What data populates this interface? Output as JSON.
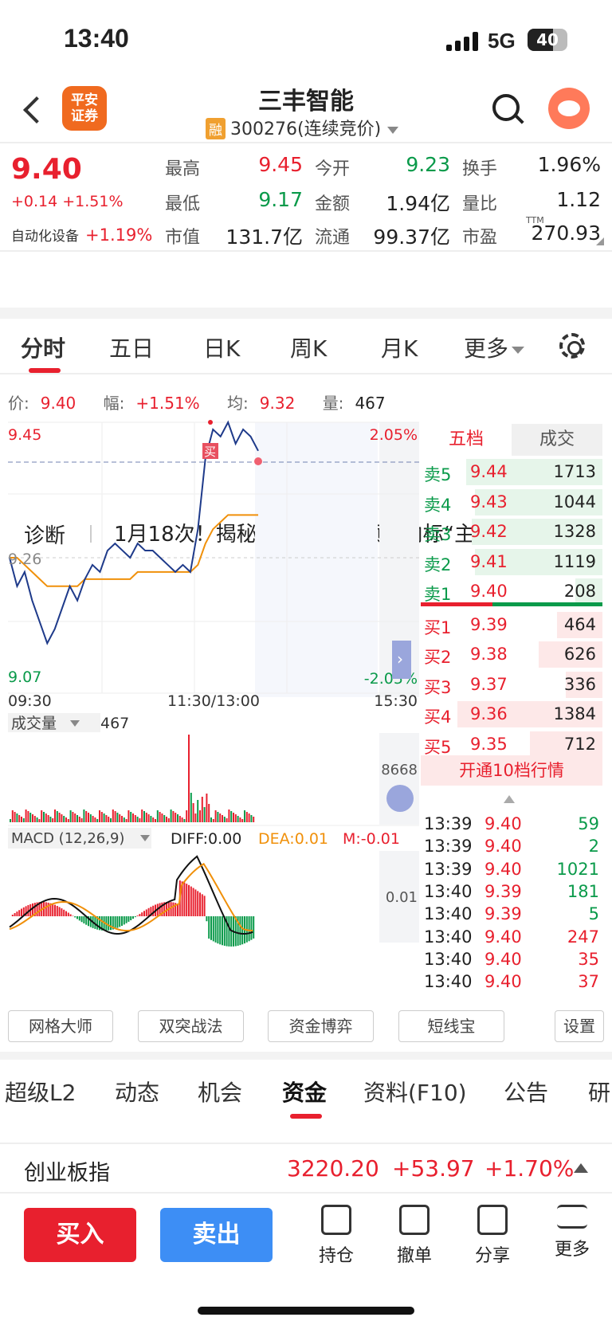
{
  "status": {
    "time": "13:40",
    "network": "5G",
    "battery": "40"
  },
  "header": {
    "title": "三丰智能",
    "code": "300276(连续竞价)",
    "rong": "融",
    "logo_top": "平安",
    "logo_bottom": "证券"
  },
  "quote": {
    "price": "9.40",
    "change": "+0.14 +1.51%",
    "sector_name": "自动化设备",
    "sector_change": "+1.19%",
    "fields": [
      {
        "l": "最高",
        "v": "9.45",
        "c": "red"
      },
      {
        "l": "今开",
        "v": "9.23",
        "c": "green"
      },
      {
        "l": "换手",
        "v": "1.96%",
        "c": ""
      },
      {
        "l": "最低",
        "v": "9.17",
        "c": "green"
      },
      {
        "l": "金额",
        "v": "1.94亿",
        "c": ""
      },
      {
        "l": "量比",
        "v": "1.12",
        "c": ""
      },
      {
        "l": "市值",
        "v": "131.7亿",
        "c": ""
      },
      {
        "l": "流通",
        "v": "99.37亿",
        "c": ""
      },
      {
        "l": "市盈",
        "v": "270.93",
        "c": ""
      }
    ],
    "ttm": "TTM"
  },
  "diagnosis": {
    "label": "诊断",
    "text": "1月18次！揭秘三丰智能高频风向标“主力”",
    "close": "✕"
  },
  "tabs": [
    "分时",
    "五日",
    "日K",
    "周K",
    "月K",
    "更多"
  ],
  "info": {
    "price_label": "价:",
    "price": "9.40",
    "amp_label": "幅:",
    "amp": "+1.51%",
    "avg_label": "均:",
    "avg": "9.32",
    "vol_label": "量:",
    "vol": "467"
  },
  "chart": {
    "y_high": "9.45",
    "y_mid": "9.26",
    "y_low": "9.07",
    "pct_high": "2.05%",
    "pct_low": "-2.05%",
    "x_start": "09:30",
    "x_mid": "11:30/13:00",
    "x_end": "15:30",
    "buy_mark": "买",
    "vol_label": "成交量",
    "vol_value": "467",
    "vol_max": "8668",
    "macd_label": "MACD (12,26,9)",
    "diff": "DIFF:0.00",
    "dea": "DEA:0.01",
    "m": "M:-0.01",
    "macd_axis": "0.01",
    "price_series": [
      9.26,
      9.22,
      9.24,
      9.2,
      9.17,
      9.14,
      9.16,
      9.19,
      9.22,
      9.2,
      9.23,
      9.25,
      9.24,
      9.27,
      9.28,
      9.27,
      9.26,
      9.28,
      9.27,
      9.27,
      9.26,
      9.25,
      9.24,
      9.25,
      9.24,
      9.3,
      9.4,
      9.44,
      9.43,
      9.45,
      9.42,
      9.44,
      9.43,
      9.41
    ],
    "avg_series": [
      9.26,
      9.26,
      9.25,
      9.24,
      9.23,
      9.22,
      9.22,
      9.22,
      9.22,
      9.22,
      9.23,
      9.23,
      9.23,
      9.23,
      9.23,
      9.23,
      9.23,
      9.24,
      9.24,
      9.24,
      9.24,
      9.24,
      9.24,
      9.24,
      9.24,
      9.25,
      9.28,
      9.3,
      9.31,
      9.32,
      9.32,
      9.32,
      9.32,
      9.32
    ]
  },
  "orderbook": {
    "tab_a": "五档",
    "tab_b": "成交",
    "asks": [
      {
        "n": "卖5",
        "p": "9.44",
        "v": "1713",
        "w": 0.75
      },
      {
        "n": "卖4",
        "p": "9.43",
        "v": "1044",
        "w": 0.7
      },
      {
        "n": "卖3",
        "p": "9.42",
        "v": "1328",
        "w": 0.72
      },
      {
        "n": "卖2",
        "p": "9.41",
        "v": "1119",
        "w": 0.7
      },
      {
        "n": "卖1",
        "p": "9.40",
        "v": "208",
        "w": 0.15
      }
    ],
    "bids": [
      {
        "n": "买1",
        "p": "9.39",
        "v": "464",
        "w": 0.25
      },
      {
        "n": "买2",
        "p": "9.38",
        "v": "626",
        "w": 0.35
      },
      {
        "n": "买3",
        "p": "9.37",
        "v": "336",
        "w": 0.2
      },
      {
        "n": "买4",
        "p": "9.36",
        "v": "1384",
        "w": 0.8
      },
      {
        "n": "买5",
        "p": "9.35",
        "v": "712",
        "w": 0.4
      }
    ],
    "open10": "开通10档行情"
  },
  "ticks": [
    {
      "t": "13:39",
      "p": "9.40",
      "v": "59",
      "c": "green"
    },
    {
      "t": "13:39",
      "p": "9.40",
      "v": "2",
      "c": "green"
    },
    {
      "t": "13:39",
      "p": "9.40",
      "v": "1021",
      "c": "green"
    },
    {
      "t": "13:40",
      "p": "9.39",
      "v": "181",
      "c": "green"
    },
    {
      "t": "13:40",
      "p": "9.39",
      "v": "5",
      "c": "green"
    },
    {
      "t": "13:40",
      "p": "9.40",
      "v": "247",
      "c": "red"
    },
    {
      "t": "13:40",
      "p": "9.40",
      "v": "35",
      "c": "red"
    },
    {
      "t": "13:40",
      "p": "9.40",
      "v": "37",
      "c": "red"
    }
  ],
  "tools": [
    "网格大师",
    "双突战法",
    "资金博弈",
    "短线宝",
    "设置"
  ],
  "bottom_tabs": [
    "超级L2",
    "动态",
    "机会",
    "资金",
    "资料(F10)",
    "公告",
    "研"
  ],
  "index": {
    "name": "创业板指",
    "value": "3220.20",
    "change": "+53.97",
    "pct": "+1.70%"
  },
  "actions": {
    "buy": "买入",
    "sell": "卖出",
    "hold": "持仓",
    "cancel": "撤单",
    "share": "分享",
    "more": "更多"
  }
}
